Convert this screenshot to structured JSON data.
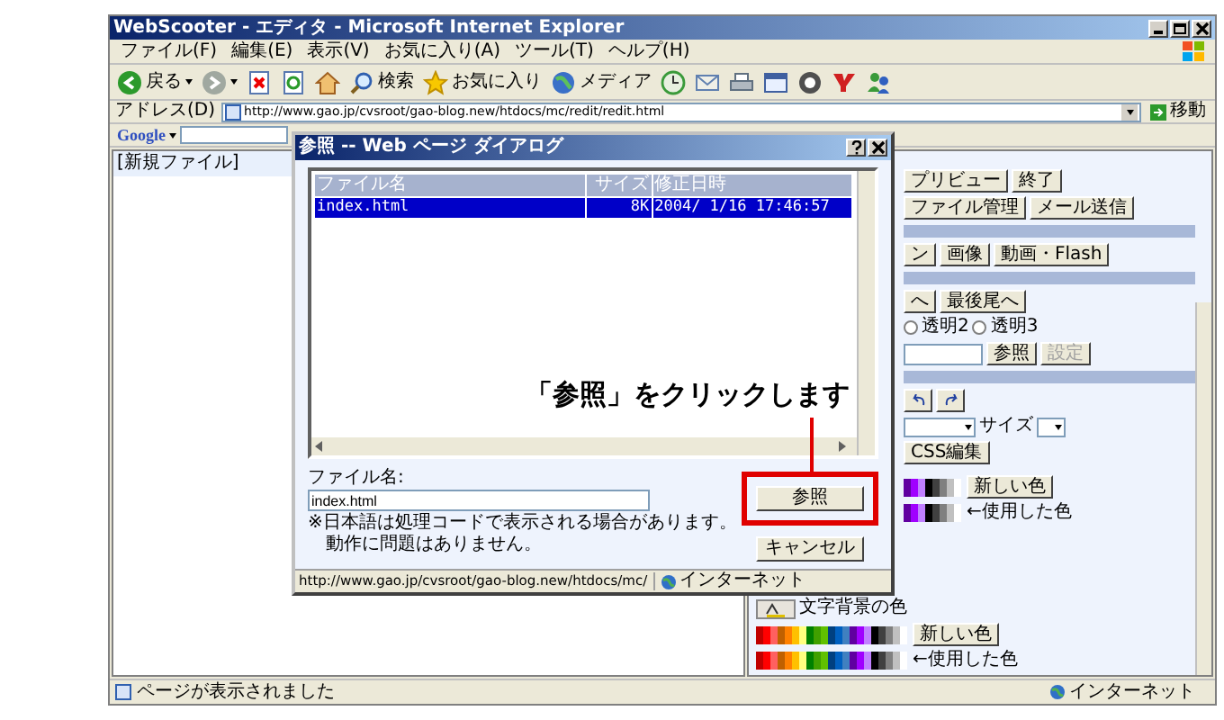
{
  "window": {
    "title": "WebScooter - エディタ - Microsoft Internet Explorer"
  },
  "menu": [
    "ファイル(F)",
    "編集(E)",
    "表示(V)",
    "お気に入り(A)",
    "ツール(T)",
    "ヘルプ(H)"
  ],
  "toolbar": [
    {
      "kind": "back",
      "label": "戻る"
    },
    {
      "kind": "forward"
    },
    {
      "kind": "stop"
    },
    {
      "kind": "refresh"
    },
    {
      "kind": "home"
    },
    {
      "kind": "search",
      "label": "検索"
    },
    {
      "kind": "favorites",
      "label": "お気に入り"
    },
    {
      "kind": "media",
      "label": "メディア"
    },
    {
      "kind": "history"
    },
    {
      "kind": "mail"
    },
    {
      "kind": "print"
    },
    {
      "kind": "edit"
    },
    {
      "kind": "messenger"
    },
    {
      "kind": "yahoo"
    },
    {
      "kind": "users"
    }
  ],
  "address": {
    "label": "アドレス(D)",
    "url": "http://www.gao.jp/cvsroot/gao-blog.new/htdocs/mc/redit/redit.html",
    "go": "移動"
  },
  "google": {
    "label": "Google"
  },
  "left_pane": {
    "text": "[新規ファイル]"
  },
  "panel": {
    "rows": [
      {
        "kind": "buttons",
        "buttons": [
          "プリビュー",
          "終了"
        ]
      },
      {
        "kind": "buttons",
        "buttons": [
          "ファイル管理",
          "メール送信"
        ]
      },
      {
        "kind": "header"
      },
      {
        "kind": "buttons",
        "buttons": [
          "ン",
          "画像",
          "動画・Flash"
        ]
      },
      {
        "kind": "header"
      },
      {
        "kind": "buttons",
        "buttons": [
          "へ",
          "最後尾へ"
        ]
      },
      {
        "kind": "radios",
        "options": [
          {
            "label": "透明2",
            "selected": false
          },
          {
            "label": "透明3",
            "selected": false
          }
        ]
      },
      {
        "kind": "file",
        "buttons": [
          {
            "label": "参照",
            "disabled": false
          },
          {
            "label": "設定",
            "disabled": true
          }
        ]
      },
      {
        "kind": "header"
      },
      {
        "kind": "undo_redo"
      },
      {
        "kind": "font",
        "label": "サイズ",
        "button": "CSS編集"
      },
      {
        "kind": "palette",
        "new_button": "新しい色",
        "used_label": "←使用した色"
      }
    ],
    "color_section": [
      {
        "kind": "title",
        "label": "文字背景の色"
      },
      {
        "kind": "palette",
        "new_button": "新しい色",
        "used_label": "←使用した色"
      }
    ]
  },
  "status_bar": {
    "text": "ページが表示されました",
    "zone": "インターネット"
  },
  "dialog": {
    "title": "参照 -- Web ページ ダイアログ",
    "columns": [
      "ファイル名",
      "サイズ",
      "修正日時"
    ],
    "rows": [
      {
        "cells": [
          "index.html",
          "8K",
          "2004/ 1/16 17:46:57"
        ],
        "selected": true
      }
    ],
    "filename_label": "ファイル名:",
    "filename_value": "index.html",
    "note": [
      "※日本語は処理コードで表示される場合があります。",
      "動作に問題はありません。"
    ],
    "buttons": [
      "参照",
      "キャンセル"
    ],
    "status_url": "http://www.gao.jp/cvsroot/gao-blog.new/htdocs/mc/",
    "zone": "インターネット"
  },
  "callout": {
    "text": "「参照」をクリックします"
  }
}
